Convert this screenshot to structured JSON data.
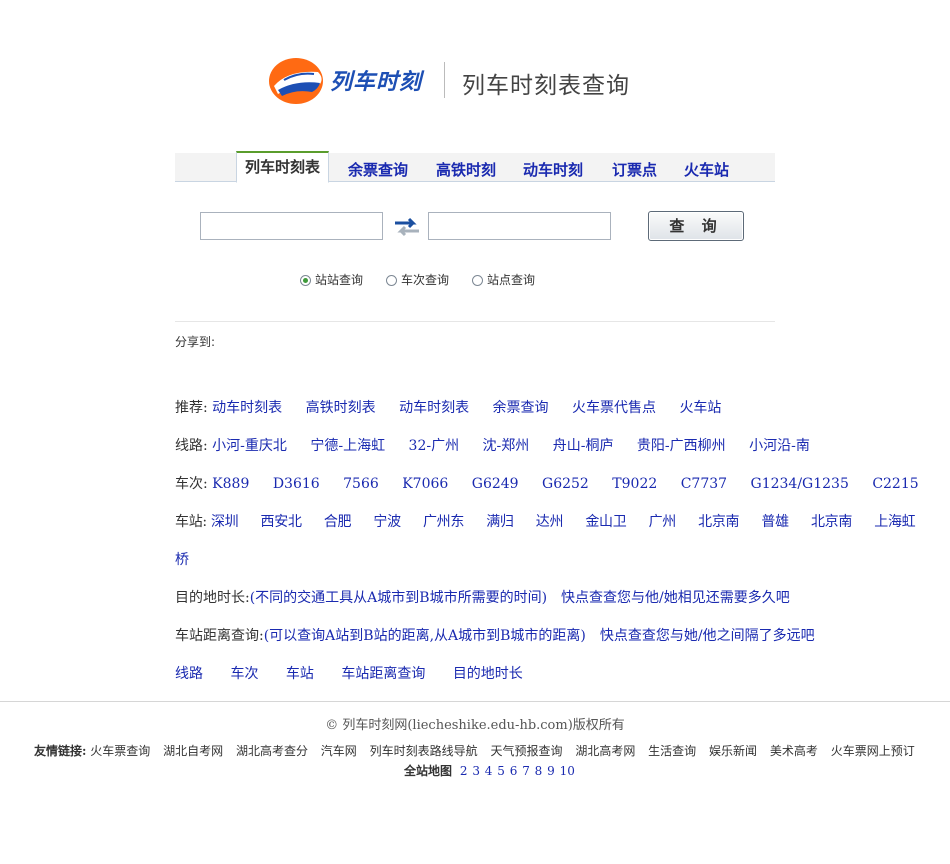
{
  "header": {
    "logo_text": "列车时刻",
    "site_title": "列车时刻表查询",
    "colors": {
      "logo_orange": "#ff6a13",
      "logo_blue": "#1d4fb4"
    }
  },
  "tabs": [
    {
      "label": "列车时刻表",
      "active": true
    },
    {
      "label": "余票查询"
    },
    {
      "label": "高铁时刻"
    },
    {
      "label": "动车时刻"
    },
    {
      "label": "订票点"
    },
    {
      "label": "火车站"
    }
  ],
  "search": {
    "from_value": "",
    "to_value": "",
    "swap_icon": "swap-arrows-icon",
    "button_label": "查 询",
    "radios": [
      {
        "label": "站站查询",
        "checked": true
      },
      {
        "label": "车次查询",
        "checked": false
      },
      {
        "label": "站点查询",
        "checked": false
      }
    ]
  },
  "share_label": "分享到:",
  "recommend": {
    "label": "推荐:",
    "links": [
      "动车时刻表",
      "高铁时刻表",
      "动车时刻表",
      "余票查询",
      "火车票代售点",
      "火车站"
    ]
  },
  "routes": {
    "label": "线路:",
    "links": [
      "小河-重庆北",
      "宁德-上海虹",
      "32-广州",
      "沈-郑州",
      "舟山-桐庐",
      "贵阳-广西柳州",
      "小河沿-南"
    ]
  },
  "trains": {
    "label": "车次:",
    "links": [
      "K889",
      "D3616",
      "7566",
      "K7066",
      "G6249",
      "G6252",
      "T9022",
      "C7737",
      "G1234/G1235",
      "C2215"
    ]
  },
  "stations": {
    "label": "车站:",
    "links": [
      "深圳",
      "西安北",
      "合肥",
      "宁波",
      "广州东",
      "满归",
      "达州",
      "金山卫",
      "广州",
      "北京南",
      "普雄",
      "北京南",
      "上海虹"
    ],
    "wrap_text": "桥"
  },
  "destination": {
    "label": "目的地时长:",
    "desc": "(不同的交通工具从A城市到B城市所需要的时间)",
    "link": "快点查查您与他/她相见还需要多久吧"
  },
  "distance": {
    "label": "车站距离查询:",
    "desc": "(可以查询A站到B站的距离,从A城市到B城市的距离)",
    "link": "快点查查您与她/他之间隔了多远吧"
  },
  "bottom_nav": [
    "线路",
    "车次",
    "车站",
    "车站距离查询",
    "目的地时长"
  ],
  "footer": {
    "copyright": "© 列车时刻网(liecheshike.edu-hb.com)版权所有",
    "friends_label": "友情链接:",
    "friends": [
      "火车票查询",
      "湖北自考网",
      "湖北高考查分",
      "汽车网",
      "列车时刻表路线导航",
      "天气预报查询",
      "湖北高考网",
      "生活查询",
      "娱乐新闻",
      "美术高考",
      "火车票网上预订"
    ],
    "sitemap_label": "全站地图",
    "sitemap_pages": [
      "2",
      "3",
      "4",
      "5",
      "6",
      "7",
      "8",
      "9",
      "10"
    ]
  }
}
